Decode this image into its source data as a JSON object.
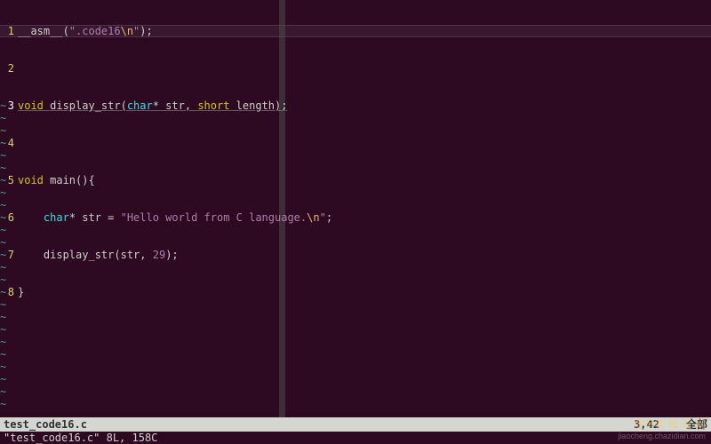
{
  "editor": {
    "line_numbers": [
      "1",
      "2",
      "3",
      "4",
      "5",
      "6",
      "7",
      "8"
    ],
    "current_line_idx": 2,
    "code": {
      "l1": {
        "a": "__asm__(",
        "s": "\".code16",
        "esc": "\\n",
        "s2": "\"",
        "b": ");"
      },
      "l2": "",
      "l3": {
        "kw1": "void",
        "fn": " display_str(",
        "ty": "char",
        "p1": "* str, ",
        "kw2": "short",
        "p2": " length);"
      },
      "l4": "",
      "l5": {
        "kw1": "void",
        "rest": " main(){"
      },
      "l6": {
        "indent": "    ",
        "ty": "char",
        "a": "* str = ",
        "s": "\"Hello world from C language.",
        "esc": "\\n",
        "s2": "\"",
        "b": ";"
      },
      "l7": {
        "indent": "    ",
        "a": "display_str(str, ",
        "num": "29",
        "b": ");"
      },
      "l8": "}"
    },
    "tilde": "~"
  },
  "status": {
    "filename": "test_code16.c",
    "position": "3,42",
    "percent": "全部"
  },
  "cmdline": "\"test_code16.c\" 8L, 158C",
  "watermark": {
    "top": "查字典  教 程 网",
    "bottom": "jiaocheng.chazidian.com"
  }
}
